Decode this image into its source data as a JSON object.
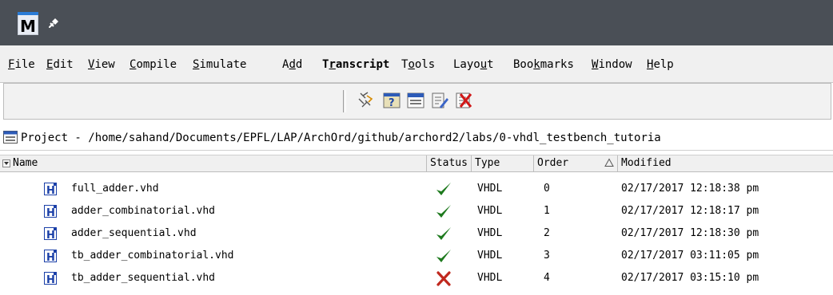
{
  "app": {
    "logo_letter": "M"
  },
  "menu": [
    {
      "id": "file",
      "label": "File",
      "mn": 0
    },
    {
      "id": "edit",
      "label": "Edit",
      "mn": 0
    },
    {
      "id": "view",
      "label": "View",
      "mn": 0
    },
    {
      "id": "compile",
      "label": "Compile",
      "mn": 0
    },
    {
      "id": "simulate",
      "label": "Simulate",
      "mn": 0
    },
    {
      "id": "add",
      "label": "Add",
      "mn": 1
    },
    {
      "id": "transcript",
      "label": "Transcript",
      "mn": 1,
      "bold": true
    },
    {
      "id": "tools",
      "label": "Tools",
      "mn": 1
    },
    {
      "id": "layout",
      "label": "Layout",
      "mn": 4
    },
    {
      "id": "bookmarks",
      "label": "Bookmarks",
      "mn": 3
    },
    {
      "id": "window",
      "label": "Window",
      "mn": 0
    },
    {
      "id": "help",
      "label": "Help",
      "mn": 0
    }
  ],
  "toolbar": {
    "buttons": [
      "compile-icon",
      "question-project-icon",
      "project-window-icon",
      "edit-document-icon",
      "close-project-icon"
    ]
  },
  "project": {
    "title": "Project - /home/sahand/Documents/EPFL/LAP/ArchOrd/github/archord2/labs/0-vhdl_testbench_tutoria"
  },
  "columns": {
    "name": "Name",
    "status": "Status",
    "type": "Type",
    "order": "Order",
    "modified": "Modified"
  },
  "files": [
    {
      "name": "full_adder.vhd",
      "status": "ok",
      "type": "VHDL",
      "order": "0",
      "modified": "02/17/2017 12:18:38 pm"
    },
    {
      "name": "adder_combinatorial.vhd",
      "status": "ok",
      "type": "VHDL",
      "order": "1",
      "modified": "02/17/2017 12:18:17 pm"
    },
    {
      "name": "adder_sequential.vhd",
      "status": "ok",
      "type": "VHDL",
      "order": "2",
      "modified": "02/17/2017 12:18:30 pm"
    },
    {
      "name": "tb_adder_combinatorial.vhd",
      "status": "ok",
      "type": "VHDL",
      "order": "3",
      "modified": "02/17/2017 03:11:05 pm"
    },
    {
      "name": "tb_adder_sequential.vhd",
      "status": "error",
      "type": "VHDL",
      "order": "4",
      "modified": "02/17/2017 03:15:10 pm"
    }
  ],
  "colors": {
    "titlebar": "#4a4f56",
    "ok": "#1e7a1e",
    "error": "#c0281e",
    "file_icon": "#1a3fa8"
  }
}
